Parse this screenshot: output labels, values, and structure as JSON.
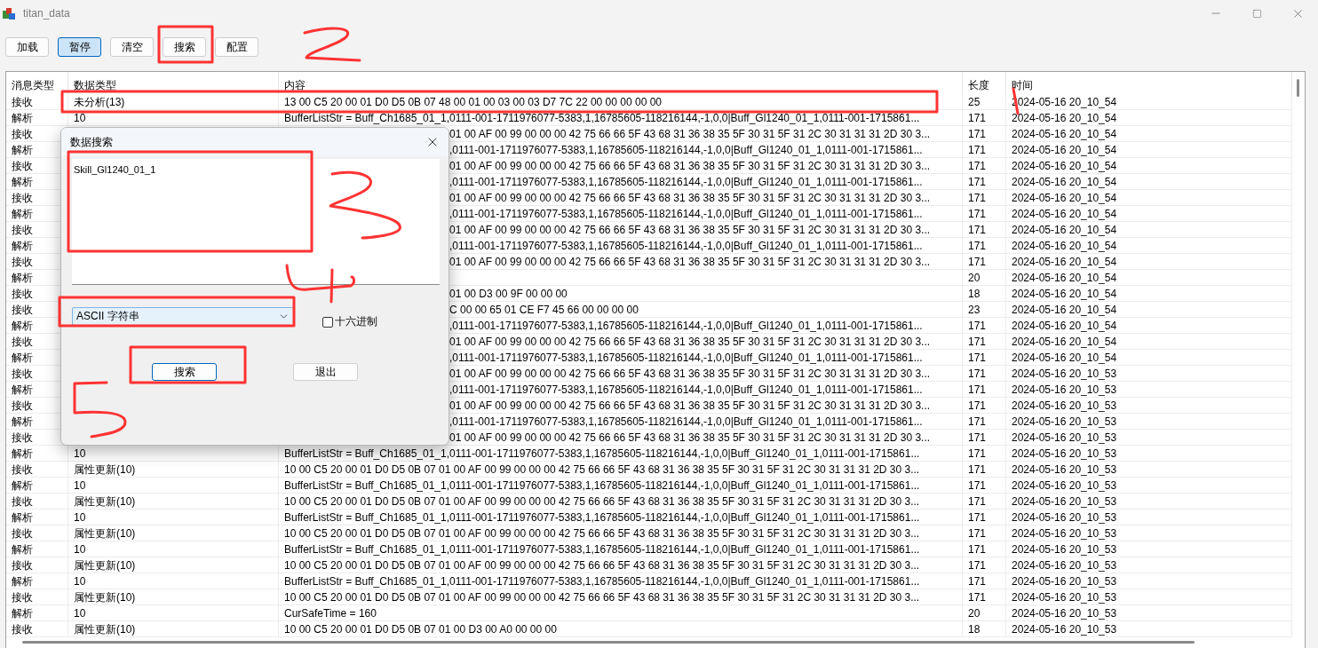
{
  "window": {
    "title": "titan_data"
  },
  "toolbar": [
    {
      "label": "加载",
      "selected": false
    },
    {
      "label": "暂停",
      "selected": true
    },
    {
      "label": "清空",
      "selected": false
    },
    {
      "label": "搜索",
      "selected": false
    },
    {
      "label": "配置",
      "selected": false
    }
  ],
  "table": {
    "columns": [
      "消息类型",
      "数据类型",
      "内容",
      "长度",
      "时间"
    ],
    "rows": [
      {
        "msg_type": "接收",
        "data_type": "未分析(13)",
        "content": "13 00 C5 20 00 01 D0 D5 0B 07 48 00 01 00 03 00 03 D7 7C 22 00 00 00 00 00",
        "length": "25",
        "time": "2024-05-16 20_10_54"
      },
      {
        "msg_type": "解析",
        "data_type": "10",
        "content": "BufferListStr = Buff_Ch1685_01_1,0111-001-1711976077-5383,1,16785605-118216144,-1,0,0|Buff_Gl1240_01_1,0111-001-1715861...",
        "length": "171",
        "time": "2024-05-16 20_10_54"
      },
      {
        "msg_type": "接收",
        "content": "01 00 AF 00 99 00 00 00 42 75 66 66 5F 43 68 31 36 38 35 5F 30 31 5F 31 2C 30 31 31 31 2D 30 3...",
        "length": "171",
        "time": "2024-05-16 20_10_54"
      },
      {
        "msg_type": "解析",
        "content": ",0111-001-1711976077-5383,1,16785605-118216144,-1,0,0|Buff_Gl1240_01_1,0111-001-1715861...",
        "length": "171",
        "time": "2024-05-16 20_10_54"
      },
      {
        "msg_type": "接收",
        "content": "01 00 AF 00 99 00 00 00 42 75 66 66 5F 43 68 31 36 38 35 5F 30 31 5F 31 2C 30 31 31 31 2D 30 3...",
        "length": "171",
        "time": "2024-05-16 20_10_54"
      },
      {
        "msg_type": "解析",
        "content": ",0111-001-1711976077-5383,1,16785605-118216144,-1,0,0|Buff_Gl1240_01_1,0111-001-1715861...",
        "length": "171",
        "time": "2024-05-16 20_10_54"
      },
      {
        "msg_type": "接收",
        "content": "01 00 AF 00 99 00 00 00 42 75 66 66 5F 43 68 31 36 38 35 5F 30 31 5F 31 2C 30 31 31 31 2D 30 3...",
        "length": "171",
        "time": "2024-05-16 20_10_54"
      },
      {
        "msg_type": "解析",
        "content": ",0111-001-1711976077-5383,1,16785605-118216144,-1,0,0|Buff_Gl1240_01_1,0111-001-1715861...",
        "length": "171",
        "time": "2024-05-16 20_10_54"
      },
      {
        "msg_type": "接收",
        "content": "01 00 AF 00 99 00 00 00 42 75 66 66 5F 43 68 31 36 38 35 5F 30 31 5F 31 2C 30 31 31 31 2D 30 3...",
        "length": "171",
        "time": "2024-05-16 20_10_54"
      },
      {
        "msg_type": "解析",
        "content": ",0111-001-1711976077-5383,1,16785605-118216144,-1,0,0|Buff_Gl1240_01_1,0111-001-1715861...",
        "length": "171",
        "time": "2024-05-16 20_10_54"
      },
      {
        "msg_type": "接收",
        "content": "01 00 AF 00 99 00 00 00 42 75 66 66 5F 43 68 31 36 38 35 5F 30 31 5F 31 2C 30 31 31 31 2D 30 3...",
        "length": "171",
        "time": "2024-05-16 20_10_54"
      },
      {
        "msg_type": "解析",
        "length": "20",
        "time": "2024-05-16 20_10_54"
      },
      {
        "msg_type": "接收",
        "content": "01 00 D3 00 9F 00 00 00",
        "length": "18",
        "time": "2024-05-16 20_10_54"
      },
      {
        "msg_type": "接收",
        "content": "C 00 00 65 01 CE F7 45 66 00 00 00 00",
        "length": "23",
        "time": "2024-05-16 20_10_54"
      },
      {
        "msg_type": "解析",
        "content": ",0111-001-1711976077-5383,1,16785605-118216144,-1,0,0|Buff_Gl1240_01_1,0111-001-1715861...",
        "length": "171",
        "time": "2024-05-16 20_10_54"
      },
      {
        "msg_type": "接收",
        "content": "01 00 AF 00 99 00 00 00 42 75 66 66 5F 43 68 31 36 38 35 5F 30 31 5F 31 2C 30 31 31 31 2D 30 3...",
        "length": "171",
        "time": "2024-05-16 20_10_54"
      },
      {
        "msg_type": "解析",
        "content": ",0111-001-1711976077-5383,1,16785605-118216144,-1,0,0|Buff_Gl1240_01_1,0111-001-1715861...",
        "length": "171",
        "time": "2024-05-16 20_10_54"
      },
      {
        "msg_type": "接收",
        "content": "01 00 AF 00 99 00 00 00 42 75 66 66 5F 43 68 31 36 38 35 5F 30 31 5F 31 2C 30 31 31 31 2D 30 3...",
        "length": "171",
        "time": "2024-05-16 20_10_53"
      },
      {
        "msg_type": "解析",
        "content": ",0111-001-1711976077-5383,1,16785605-118216144,-1,0,0|Buff_Gl1240_01_1,0111-001-1715861...",
        "length": "171",
        "time": "2024-05-16 20_10_53"
      },
      {
        "msg_type": "接收",
        "content": "01 00 AF 00 99 00 00 00 42 75 66 66 5F 43 68 31 36 38 35 5F 30 31 5F 31 2C 30 31 31 31 2D 30 3...",
        "length": "171",
        "time": "2024-05-16 20_10_53"
      },
      {
        "msg_type": "解析",
        "content": ",0111-001-1711976077-5383,1,16785605-118216144,-1,0,0|Buff_Gl1240_01_1,0111-001-1715861...",
        "length": "171",
        "time": "2024-05-16 20_10_53"
      },
      {
        "msg_type": "接收",
        "content": "01 00 AF 00 99 00 00 00 42 75 66 66 5F 43 68 31 36 38 35 5F 30 31 5F 31 2C 30 31 31 31 2D 30 3...",
        "length": "171",
        "time": "2024-05-16 20_10_53"
      },
      {
        "msg_type": "解析",
        "data_type": "10",
        "content": "BufferListStr = Buff_Ch1685_01_1,0111-001-1711976077-5383,1,16785605-118216144,-1,0,0|Buff_Gl1240_01_1,0111-001-1715861...",
        "length": "171",
        "time": "2024-05-16 20_10_53"
      },
      {
        "msg_type": "接收",
        "data_type": "属性更新(10)",
        "content": "10 00 C5 20 00 01 D0 D5 0B 07 01 00 AF 00 99 00 00 00 42 75 66 66 5F 43 68 31 36 38 35 5F 30 31 5F 31 2C 30 31 31 31 2D 30 3...",
        "length": "171",
        "time": "2024-05-16 20_10_53"
      },
      {
        "msg_type": "解析",
        "data_type": "10",
        "content": "BufferListStr = Buff_Ch1685_01_1,0111-001-1711976077-5383,1,16785605-118216144,-1,0,0|Buff_Gl1240_01_1,0111-001-1715861...",
        "length": "171",
        "time": "2024-05-16 20_10_53"
      },
      {
        "msg_type": "接收",
        "data_type": "属性更新(10)",
        "content": "10 00 C5 20 00 01 D0 D5 0B 07 01 00 AF 00 99 00 00 00 42 75 66 66 5F 43 68 31 36 38 35 5F 30 31 5F 31 2C 30 31 31 31 2D 30 3...",
        "length": "171",
        "time": "2024-05-16 20_10_53"
      },
      {
        "msg_type": "解析",
        "data_type": "10",
        "content": "BufferListStr = Buff_Ch1685_01_1,0111-001-1711976077-5383,1,16785605-118216144,-1,0,0|Buff_Gl1240_01_1,0111-001-1715861...",
        "length": "171",
        "time": "2024-05-16 20_10_53"
      },
      {
        "msg_type": "接收",
        "data_type": "属性更新(10)",
        "content": "10 00 C5 20 00 01 D0 D5 0B 07 01 00 AF 00 99 00 00 00 42 75 66 66 5F 43 68 31 36 38 35 5F 30 31 5F 31 2C 30 31 31 31 2D 30 3...",
        "length": "171",
        "time": "2024-05-16 20_10_53"
      },
      {
        "msg_type": "解析",
        "data_type": "10",
        "content": "BufferListStr = Buff_Ch1685_01_1,0111-001-1711976077-5383,1,16785605-118216144,-1,0,0|Buff_Gl1240_01_1,0111-001-1715861...",
        "length": "171",
        "time": "2024-05-16 20_10_53"
      },
      {
        "msg_type": "接收",
        "data_type": "属性更新(10)",
        "content": "10 00 C5 20 00 01 D0 D5 0B 07 01 00 AF 00 99 00 00 00 42 75 66 66 5F 43 68 31 36 38 35 5F 30 31 5F 31 2C 30 31 31 31 2D 30 3...",
        "length": "171",
        "time": "2024-05-16 20_10_53"
      },
      {
        "msg_type": "解析",
        "data_type": "10",
        "content": "BufferListStr = Buff_Ch1685_01_1,0111-001-1711976077-5383,1,16785605-118216144,-1,0,0|Buff_Gl1240_01_1,0111-001-1715861...",
        "length": "171",
        "time": "2024-05-16 20_10_53"
      },
      {
        "msg_type": "接收",
        "data_type": "属性更新(10)",
        "content": "10 00 C5 20 00 01 D0 D5 0B 07 01 00 AF 00 99 00 00 00 42 75 66 66 5F 43 68 31 36 38 35 5F 30 31 5F 31 2C 30 31 31 31 2D 30 3...",
        "length": "171",
        "time": "2024-05-16 20_10_53"
      },
      {
        "msg_type": "解析",
        "data_type": "10",
        "content": "CurSafeTime = 160",
        "length": "20",
        "time": "2024-05-16 20_10_53"
      },
      {
        "msg_type": "接收",
        "data_type": "属性更新(10)",
        "content": "10 00 C5 20 00 01 D0 D5 0B 07 01 00 D3 00 A0 00 00 00",
        "length": "18",
        "time": "2024-05-16 20_10_53"
      }
    ]
  },
  "dialog": {
    "title": "数据搜索",
    "search_text": "Skill_Gl1240_01_1",
    "encoding": "ASCII 字符串",
    "hex_checkbox": {
      "label": "十六进制",
      "checked": false
    },
    "buttons": [
      {
        "label": "搜索",
        "default": true
      },
      {
        "label": "退出",
        "default": false
      }
    ]
  }
}
